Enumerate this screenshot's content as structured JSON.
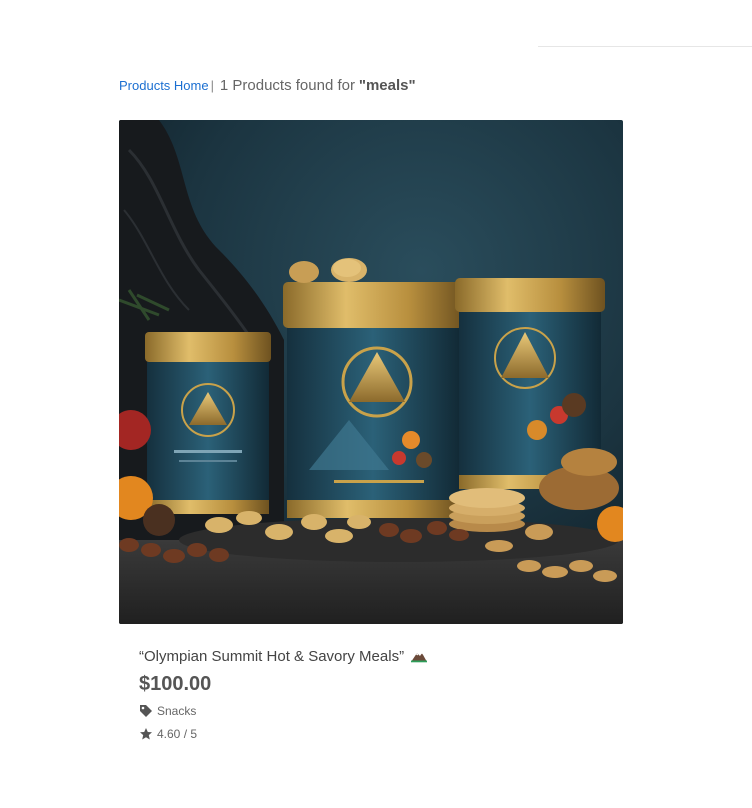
{
  "breadcrumb": {
    "home_label": "Products Home",
    "separator": "|",
    "result_text": "1 Products found for",
    "query": "\"meals\""
  },
  "products": [
    {
      "title": "“Olympian Summit Hot & Savory Meals”",
      "title_icon": "mountain-emoji-icon",
      "price": "$100.00",
      "category_icon": "tag-icon",
      "category": "Snacks",
      "rating_icon": "star-icon",
      "rating": "4.60 / 5"
    }
  ],
  "colors": {
    "link": "#1b6fd1",
    "text": "#444444",
    "muted": "#666666",
    "image_background": "#1d3641",
    "can_gold": "#c9a24a",
    "can_teal": "#1f4a5e"
  }
}
